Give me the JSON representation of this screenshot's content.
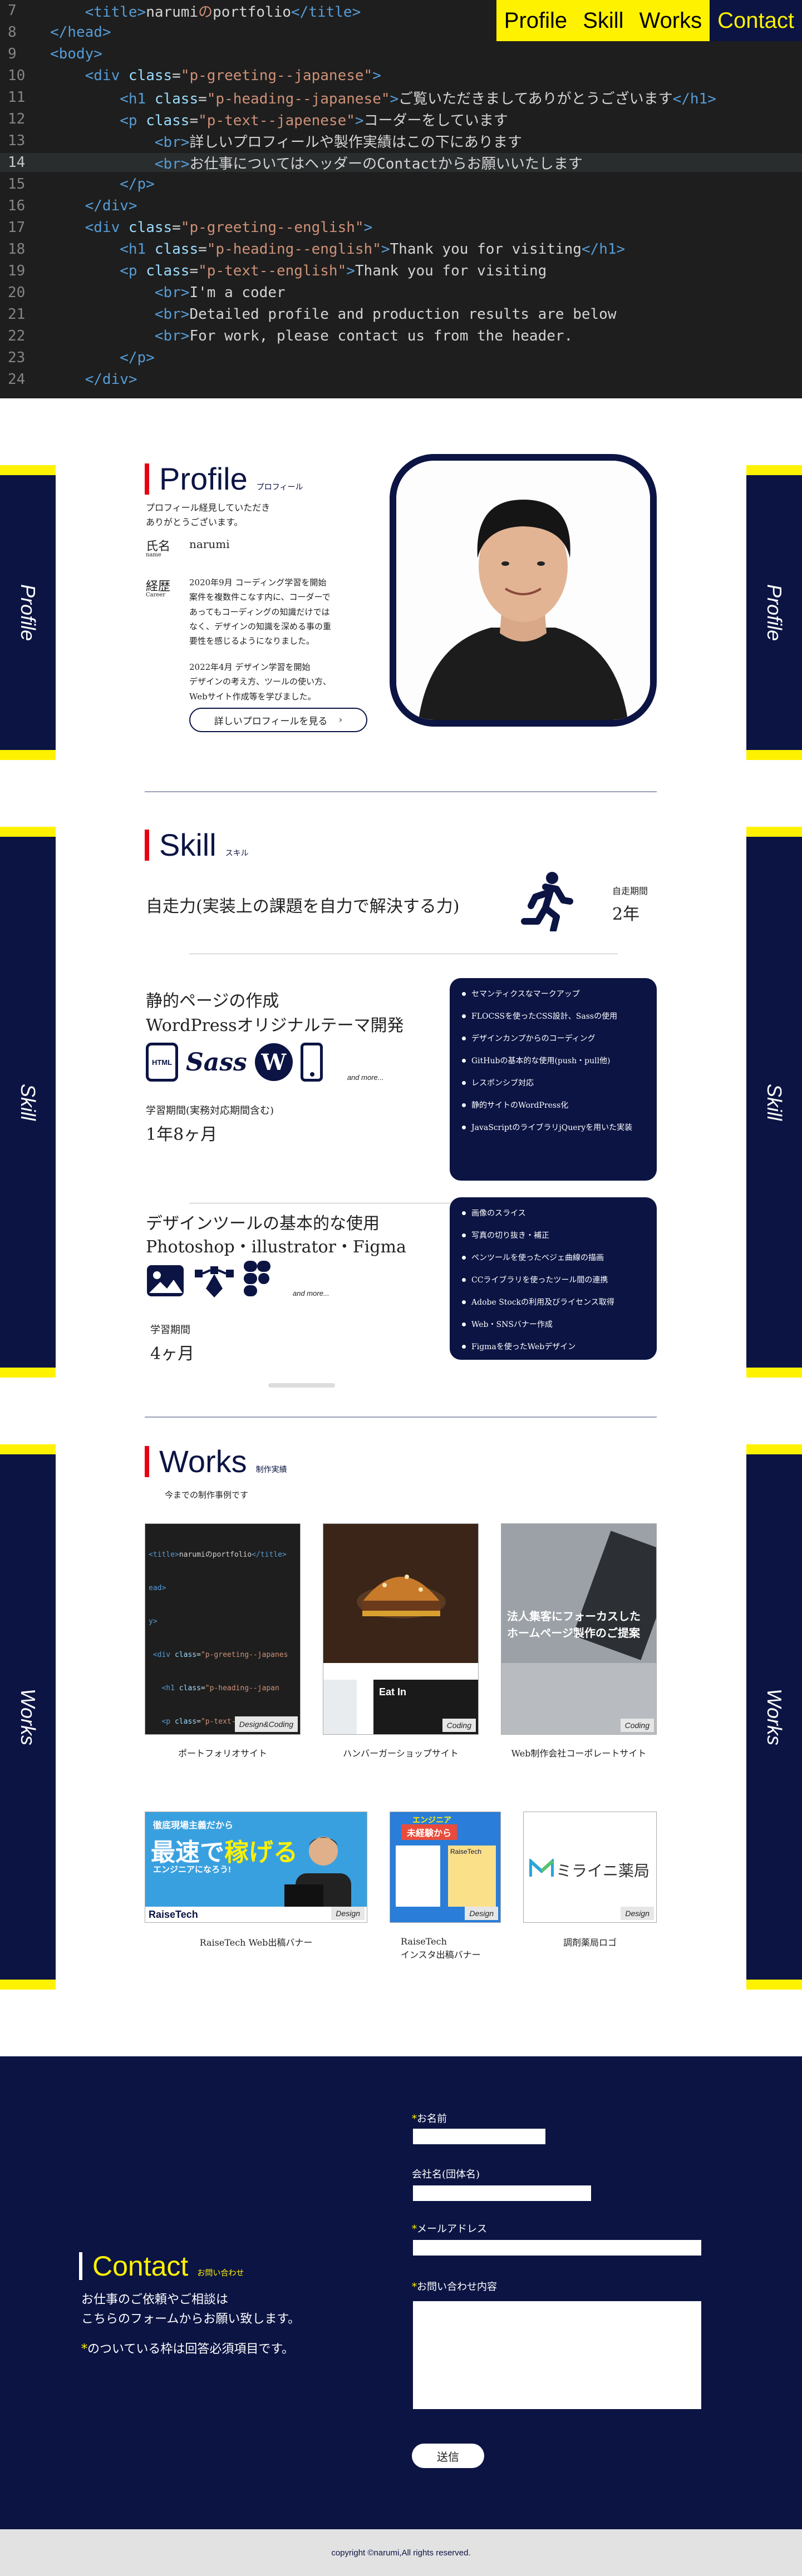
{
  "nav": {
    "items": [
      "Profile",
      "Skill",
      "Works",
      "Contact"
    ]
  },
  "code": {
    "lines": [
      {
        "n": "7",
        "parts": [
          [
            "tg",
            "    <title>"
          ],
          [
            "",
            "narumi"
          ],
          [
            "st",
            "の"
          ],
          [
            "",
            "portfolio"
          ],
          [
            "tg",
            "</title>"
          ]
        ]
      },
      {
        "n": "8",
        "parts": [
          [
            "tg",
            "</head>"
          ]
        ]
      },
      {
        "n": "9",
        "parts": [
          [
            "tg",
            "<body>"
          ]
        ]
      },
      {
        "n": "10",
        "parts": [
          [
            "tg",
            "    <div "
          ],
          [
            "at",
            "class"
          ],
          [
            "",
            "="
          ],
          [
            "st",
            "\"p-greeting--japanese\""
          ],
          [
            "tg",
            ">"
          ]
        ]
      },
      {
        "n": "11",
        "parts": [
          [
            "tg",
            "        <h1 "
          ],
          [
            "at",
            "class"
          ],
          [
            "",
            "="
          ],
          [
            "st",
            "\"p-heading--japanese\""
          ],
          [
            "tg",
            ">"
          ],
          [
            "",
            "ご覧いただきましてありがとうございます"
          ],
          [
            "tg",
            "</h1>"
          ]
        ]
      },
      {
        "n": "12",
        "parts": [
          [
            "tg",
            "        <p "
          ],
          [
            "at",
            "class"
          ],
          [
            "",
            "="
          ],
          [
            "st",
            "\"p-text--japenese\""
          ],
          [
            "tg",
            ">"
          ],
          [
            "",
            "コーダーをしています"
          ]
        ]
      },
      {
        "n": "13",
        "parts": [
          [
            "tg",
            "            <br>"
          ],
          [
            "",
            "詳しいプロフィールや製作実績はこの下にあります"
          ]
        ]
      },
      {
        "n": "14",
        "parts": [
          [
            "tg",
            "            <br>"
          ],
          [
            "",
            "お仕事についてはヘッダーの"
          ],
          [
            "",
            "Contact"
          ],
          [
            "",
            "からお願いいたします"
          ]
        ],
        "hl": true
      },
      {
        "n": "15",
        "parts": [
          [
            "tg",
            "        </p>"
          ]
        ]
      },
      {
        "n": "16",
        "parts": [
          [
            "tg",
            "    </div>"
          ]
        ]
      },
      {
        "n": "17",
        "parts": [
          [
            "tg",
            "    <div "
          ],
          [
            "at",
            "class"
          ],
          [
            "",
            "="
          ],
          [
            "st",
            "\"p-greeting--english\""
          ],
          [
            "tg",
            ">"
          ]
        ]
      },
      {
        "n": "18",
        "parts": [
          [
            "tg",
            "        <h1 "
          ],
          [
            "at",
            "class"
          ],
          [
            "",
            "="
          ],
          [
            "st",
            "\"p-heading--english\""
          ],
          [
            "tg",
            ">"
          ],
          [
            "",
            "Thank you for visiting"
          ],
          [
            "tg",
            "</h1>"
          ]
        ]
      },
      {
        "n": "19",
        "parts": [
          [
            "tg",
            "        <p "
          ],
          [
            "at",
            "class"
          ],
          [
            "",
            "="
          ],
          [
            "st",
            "\"p-text--english\""
          ],
          [
            "tg",
            ">"
          ],
          [
            "",
            "Thank you for visiting"
          ]
        ]
      },
      {
        "n": "20",
        "parts": [
          [
            "tg",
            "            <br>"
          ],
          [
            "",
            "I'm a coder"
          ]
        ]
      },
      {
        "n": "21",
        "parts": [
          [
            "tg",
            "            <br>"
          ],
          [
            "",
            "Detailed profile and production results are below"
          ]
        ]
      },
      {
        "n": "22",
        "parts": [
          [
            "tg",
            "            <br>"
          ],
          [
            "",
            "For work, please contact us from the header."
          ]
        ]
      },
      {
        "n": "23",
        "parts": [
          [
            "tg",
            "        </p>"
          ]
        ]
      },
      {
        "n": "24",
        "parts": [
          [
            "tg",
            "    </div>"
          ]
        ]
      }
    ]
  },
  "profile": {
    "side": "Profile",
    "title": "Profile",
    "sub": "プロフィール",
    "intro": "プロフィール経見していただき\nありがとうございます。",
    "name_label": "氏名",
    "name_label_en": "name",
    "name": "narumi",
    "career_label": "経歴",
    "career_label_en": "Career",
    "career_1": "2020年9月 コーディング学習を開始\n案件を複数件こなす内に、コーダーで\nあってもコーディングの知識だけでは\nなく、デザインの知識を深める事の重\n要性を感じるようになりました。",
    "career_2": "2022年4月 デザイン学習を開始\nデザインの考え方、ツールの使い方、\nWebサイト作成等を学びました。",
    "button": "詳しいプロフィールを見る"
  },
  "skill": {
    "side": "Skill",
    "title": "Skill",
    "sub": "スキル",
    "self_run": "自走力(実装上の課題を自力で解決する力)",
    "self_run_label": "自走期間",
    "self_run_value": "2年",
    "coding_title_1": "静的ページの作成",
    "coding_title_2": "WordPressオリジナルテーマ開発",
    "coding_icons": [
      "HTML",
      "Sass",
      "W",
      "phone"
    ],
    "and_more": "and more...",
    "coding_period_label": "学習期間(実務対応期間含む)",
    "coding_period": "1年8ヶ月",
    "coding_list": [
      "セマンティクスなマークアップ",
      "FLOCSSを使ったCSS設計、Sassの使用",
      "デザインカンプからのコーディング",
      "GitHubの基本的な使用(push・pull他)",
      "レスポンシブ対応",
      "静的サイトのWordPress化",
      "JavaScriptのライブラリjQueryを用いた実装"
    ],
    "design_title_1": "デザインツールの基本的な使用",
    "design_title_2": "Photoshop・illustrator・Figma",
    "design_period_label": "学習期間",
    "design_period": "4ヶ月",
    "design_list": [
      "画像のスライス",
      "写真の切り抜き・補正",
      "ペンツールを使ったベジェ曲線の描画",
      "CCライブラリを使ったツール間の連携",
      "Adobe Stockの利用及びライセンス取得",
      "Web・SNSバナー作成",
      "Figmaを使ったWebデザイン"
    ]
  },
  "works": {
    "side": "Works",
    "title": "Works",
    "sub": "制作実績",
    "intro": "今までの制作事例です",
    "items": [
      {
        "caption": "ポートフォリオサイト",
        "badge": "Design&Coding"
      },
      {
        "caption": "ハンバーガーショップサイト",
        "badge": "Coding"
      },
      {
        "caption": "Web制作会社コーポレートサイト",
        "badge": "Coding"
      },
      {
        "caption": "RaiseTech Web出稿バナー",
        "badge": "Design"
      },
      {
        "caption": "RaiseTech\nインスタ出稿バナー",
        "badge": "Design"
      },
      {
        "caption": "調剤薬局ロゴ",
        "badge": "Design"
      }
    ],
    "img_text": {
      "eat_in": "Eat In",
      "corp_1": "法人集客にフォーカスした",
      "corp_2": "ホームページ製作のご提案",
      "banner_1": "徹底現場主義だから",
      "banner_2": "最速で",
      "banner_3": "稼げる",
      "banner_4": "エンジニアになろう!",
      "banner_brand": "RaiseTech",
      "insta_1": "エンジニア",
      "insta_2": "未経験から",
      "insta_3": "RaiseTech",
      "logo": "ミライニ薬局"
    }
  },
  "contact": {
    "title": "Contact",
    "sub": "お問い合わせ",
    "text_1": "お仕事のご依頼やご相談は",
    "text_2": "こちらのフォームからお願い致します。",
    "note_mark": "*",
    "note": "のついている枠は回答必須項目です。",
    "f_name": "お名前",
    "f_company": "会社名(団体名)",
    "f_mail": "メールアドレス",
    "f_message": "お問い合わせ内容",
    "submit": "送信"
  },
  "footer": {
    "copyright": "copyright ©narumi,All rights reserved."
  }
}
